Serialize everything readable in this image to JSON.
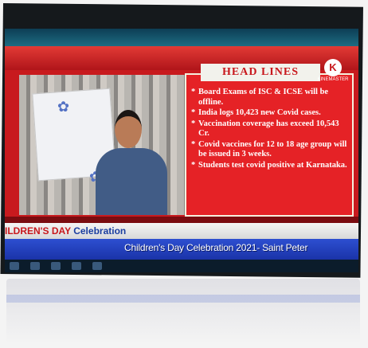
{
  "broadcast": {
    "panel_title": "HEAD LINES",
    "logo_letter": "K",
    "logo_text": "KINEMASTER",
    "headlines": [
      "Board Exams of ISC & ICSE will be offline.",
      "India logs 10,423 new Covid cases.",
      "Vaccination coverage has exceed 10,543 Cr.",
      "Covid vaccines for 12 to 18 age group will be issued in 3 weeks.",
      "Students test covid positive at Karnataka."
    ],
    "bullet": "*",
    "banner_main": "ILDREN'S DAY",
    "banner_sub": "Celebration",
    "ticker": "Children's Day Celebration 2021- Saint Peter"
  },
  "colors": {
    "frame_red": "#c81a1e",
    "panel_red": "#e52226",
    "ticker_blue": "#1a33a8"
  }
}
